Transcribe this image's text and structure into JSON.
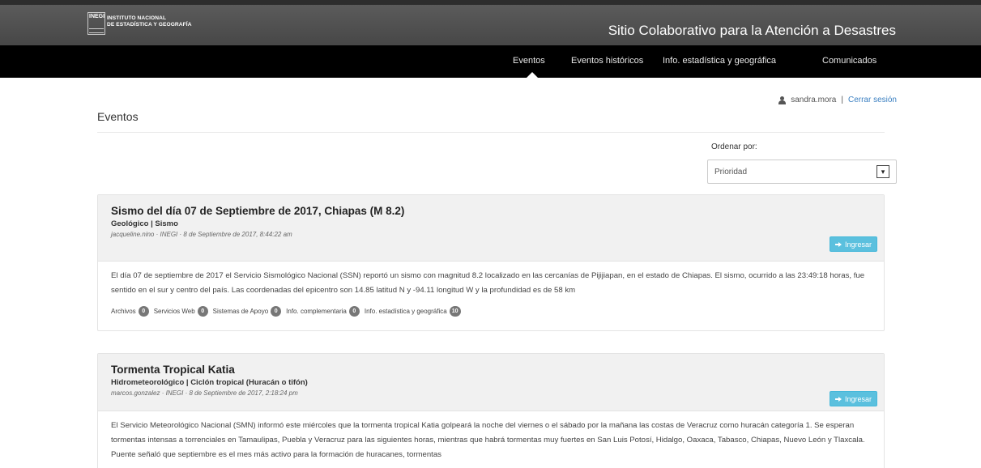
{
  "header": {
    "logo_mark": "INEGI",
    "logo_line1": "INSTITUTO NACIONAL",
    "logo_line2": "DE ESTADÍSTICA Y GEOGRAFÍA",
    "site_title": "Sitio Colaborativo para la Atención a Desastres"
  },
  "nav": {
    "items": [
      {
        "label": "Eventos"
      },
      {
        "label": "Eventos históricos"
      },
      {
        "label": "Info. estadística y geográfica"
      },
      {
        "label": "Comunicados"
      }
    ],
    "active": "Eventos"
  },
  "user": {
    "icon": "user-icon",
    "username": "sandra.mora",
    "separator": "|",
    "logout_label": "Cerrar sesión"
  },
  "page": {
    "title": "Eventos"
  },
  "sort": {
    "label": "Ordenar por:",
    "selected": "Prioridad",
    "arrow": "▾"
  },
  "colors": {
    "header_bg": "#4f4f4f",
    "nav_bg": "#000000",
    "button_info": "#5bc0de",
    "badge": "#777777",
    "link": "#3a7fc1"
  },
  "events": [
    {
      "title": "Sismo del día 07 de Septiembre de 2017, Chiapas (M 8.2)",
      "category": "Geológico | Sismo",
      "meta": "jacqueline.nino · INEGI · 8 de Septiembre de 2017, 8:44:22 am",
      "button_label": "Ingresar",
      "description": "El día 07 de septiembre de 2017 el Servicio Sismológico Nacional (SSN) reportó un sismo con magnitud 8.2 localizado en las cercanías de Pijijiapan, en el estado de Chiapas. El sismo, ocurrido a las 23:49:18 horas, fue sentido en el sur y centro del país. Las coordenadas del epicentro son 14.85 latitud N y -94.11 longitud W y la profundidad es de 58 km",
      "links": [
        {
          "label": "Archivos",
          "count": "0"
        },
        {
          "label": "Servicios Web",
          "count": "0"
        },
        {
          "label": "Sistemas de Apoyo",
          "count": "0"
        },
        {
          "label": "Info. complementaria",
          "count": "0"
        },
        {
          "label": "Info. estadística y geográfica",
          "count": "10"
        }
      ]
    },
    {
      "title": "Tormenta Tropical Katia",
      "category": "Hidrometeorológico | Ciclón tropical (Huracán o tifón)",
      "meta": "marcos.gonzalez · INEGI · 8 de Septiembre de 2017, 2:18:24 pm",
      "button_label": "Ingresar",
      "description": "El Servicio Meteorológico Nacional (SMN) informó este miércoles que la tormenta tropical Katia golpeará la noche del viernes o el sábado por la mañana las costas de Veracruz como huracán categoría 1. Se esperan tormentas intensas a torrenciales en Tamaulipas, Puebla y Veracruz para las siguientes horas, mientras que habrá tormentas muy fuertes en San Luis Potosí, Hidalgo, Oaxaca, Tabasco, Chiapas, Nuevo León y Tlaxcala. Puente señaló que septiembre es el mes más activo para la formación de huracanes, tormentas"
    }
  ]
}
